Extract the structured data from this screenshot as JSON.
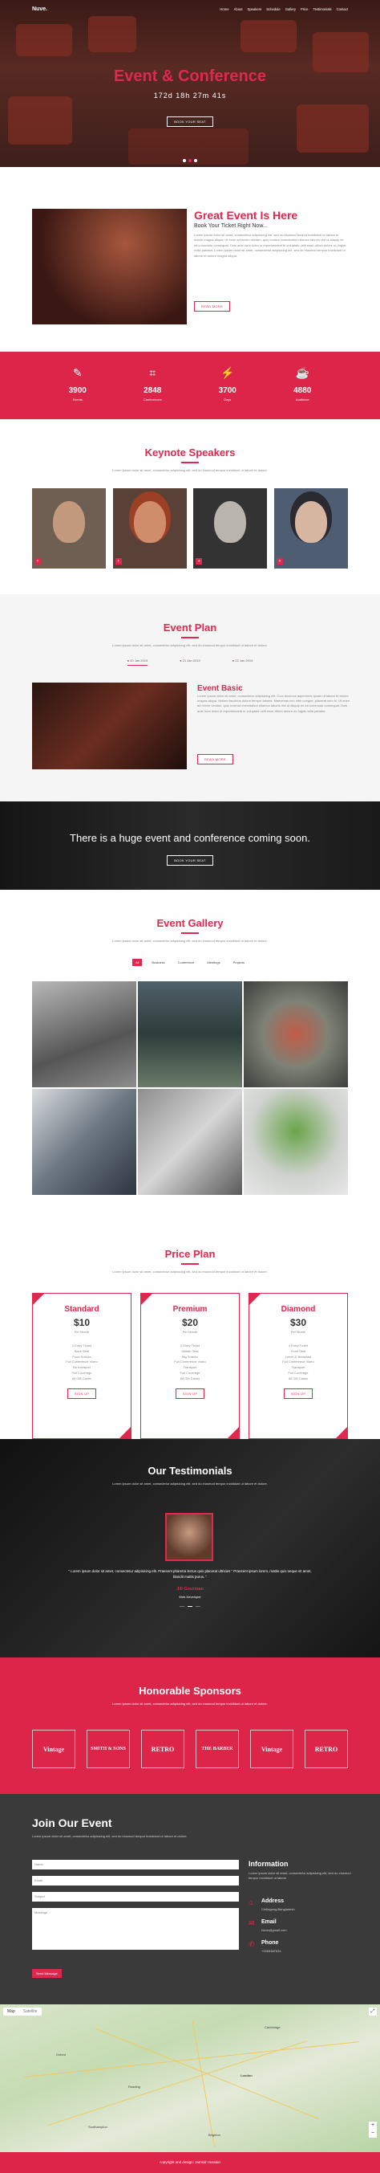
{
  "nav": {
    "logo": "Nuve.",
    "items": [
      "Home",
      "About",
      "Speakers",
      "Schedule",
      "Gallery",
      "Price",
      "Testimonials",
      "Contact"
    ]
  },
  "hero": {
    "title": "Event & Conference",
    "countdown": "172d 18h 27m 41s",
    "button": "BOOK YOUR SEAT"
  },
  "about": {
    "title": "Great Event Is Here",
    "subtitle": "Book Your Ticket Right Now...",
    "text": "Lorem ipsum dolor sit amet, consectetur adipisicing elit, sed do eiusmod tempor incididunt ut labore et dolore magna aliqua. Ut enim ad minim veniam, quis nostrud exercitation ullamco laboris nisi ut aliquip ex ea commodo consequat. Duis aute irure dolor in reprehenderit in voluptate velit esse cillum dolore eu fugiat nulla pariatur. Lorem ipsum dolor sit amet, consectetur adipisicing elit, sed do eiusmod tempor incididunt ut labore et dolore magna aliqua.",
    "button": "READ MORE"
  },
  "counters": [
    {
      "icon": "pencil-icon",
      "glyph": "✎",
      "value": "3900",
      "label": "Events"
    },
    {
      "icon": "crop-icon",
      "glyph": "⌗",
      "value": "2848",
      "label": "Conferences"
    },
    {
      "icon": "bolt-icon",
      "glyph": "⚡",
      "value": "3700",
      "label": "Days"
    },
    {
      "icon": "coffee-icon",
      "glyph": "☕",
      "value": "4880",
      "label": "Audience"
    }
  ],
  "speakers": {
    "title": "Keynote Speakers",
    "subtitle": "Lorem ipsum dolor sit amet, consectetur adipisicing elit, sed do eiusmod tempor incididunt ut labore et dolore."
  },
  "plan": {
    "title": "Event Plan",
    "subtitle": "Lorem ipsum dolor sit amet, consectetur adipisicing elit, sed do eiusmod tempor incididunt ut labore et dolore.",
    "tabs": [
      "20 Jan 2019",
      "21 Jan 2019",
      "22 Jan 2019"
    ],
    "item_title": "Event Basic",
    "item_text": "Lorem ipsum dolor sit amet, consectetur adipisicing elit. Cum ducimus asperiores ipsam ut labore et dolore magna aliqua. Nullam faucibus dolore tempor laboris. Maecenas nec nibh congue, placerat sem id. Ut enim ad minim veniam, quis nostrud exercitation ullamco laboris nisi ut aliquip ex ea commodo consequat. Duis aute irure dolor in reprehenderit in voluptate velit esse cillum dolore eu fugiat nulla pariatur.",
    "button": "READ MORE"
  },
  "cta": {
    "title": "There is a huge event and conference coming soon.",
    "button": "BOOK YOUR SEAT"
  },
  "gallery": {
    "title": "Event Gallery",
    "subtitle": "Lorem ipsum dolor sit amet, consectetur adipisicing elit, sed do eiusmod tempor incididunt ut labore et dolore.",
    "filters": [
      "All",
      "Business",
      "Conference",
      "Meetings",
      "Projects"
    ]
  },
  "price": {
    "title": "Price Plan",
    "subtitle": "Lorem ipsum dolor sit amet, consectetur adipisicing elit, sed do eiusmod tempor incididunt ut labore et dolore.",
    "plans": [
      {
        "name": "Standard",
        "price": "$10",
        "per": "Per Month",
        "features": [
          "1 Entry Ticket",
          "Back Seat",
          "Food Snacks",
          "Full Conference Video",
          "No transport",
          "Full Coverage",
          "All Gift Cases"
        ],
        "button": "SIGN UP"
      },
      {
        "name": "Premium",
        "price": "$20",
        "per": "Per Month",
        "features": [
          "2 Entry Ticket",
          "Middle Seat",
          "Big Snacks",
          "Full Conference Video",
          "Transport",
          "Full Coverage",
          "All Gift Cases"
        ],
        "button": "SIGN UP"
      },
      {
        "name": "Diamond",
        "price": "$30",
        "per": "Per Month",
        "features": [
          "4 Entry Ticket",
          "Front Seat",
          "Lunch & Breakfast",
          "Full Conference Video",
          "Transport",
          "Full Coverage",
          "All Gift Cases"
        ],
        "button": "SIGN UP"
      }
    ]
  },
  "testimonials": {
    "title": "Our Testimonials",
    "subtitle": "Lorem ipsum dolor sit amet, consectetur adipisicing elit, sed do eiusmod tempor incididunt ut labore et dolore.",
    "quote": "\" Lorem ipsum dolor sit amet, consectetur adipisicing elit. Praesent pharetra lectus quis placerat ultricies \" Praesent ipsum lorem, mattis quis neque sit amet, blandit mattis purus. \"",
    "name": "Jill Goorman",
    "role": "Web Developer"
  },
  "sponsors": {
    "title": "Honorable Sponsors",
    "subtitle": "Lorem ipsum dolor sit amet, consectetur adipisicing elit, sed do eiusmod tempor incididunt ut labore et dolore.",
    "logos": [
      "Vintage",
      "SMITH & SONS",
      "RETRO",
      "THE BARBER",
      "Vintage",
      "RETRO"
    ]
  },
  "join": {
    "title": "Join Our Event",
    "subtitle": "Lorem ipsum dolor sit amet, consectetur adipisicing elit, sed do eiusmod tempor incididunt ut labore et dolore.",
    "fields": [
      "Name",
      "Email",
      "Subject",
      "Message"
    ],
    "button": "Send Message",
    "info_title": "Information",
    "info_text": "Lorem ipsum dolor sit amet, consectetur adipisicing elit, sed do eiusmod tempor incididunt ut labore.",
    "address_label": "Address",
    "address": "Chittagong,Bangladesh",
    "email_label": "Email",
    "email": "Nuve@gmail.com",
    "phone_label": "Phone",
    "phone": "+0065387634"
  },
  "map": {
    "tabs": [
      "Map",
      "Satellite"
    ],
    "cities": [
      "Oxford",
      "London",
      "Reading",
      "Brighton",
      "Cambridge",
      "Southampton"
    ]
  },
  "footer": "copyright and design: Jamsid Hussain",
  "colors": {
    "accent": "#e0284f"
  }
}
